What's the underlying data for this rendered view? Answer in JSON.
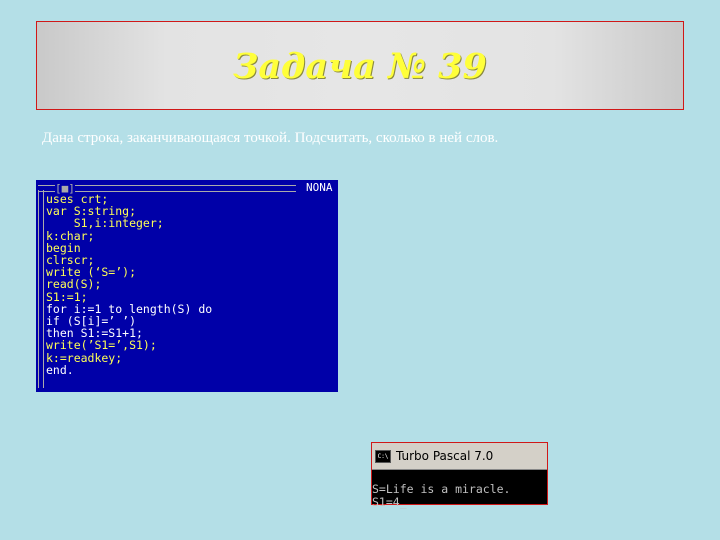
{
  "slide": {
    "title": "Задача № 39",
    "task_text": "Дана строка, заканчивающаяся точкой. Подсчитать, сколько в ней слов."
  },
  "editor": {
    "close_button": "[■]",
    "filename": "NONA",
    "lines": [
      "uses crt;",
      "var S:string;",
      "    S1,i:integer;",
      "k:char;",
      "begin",
      "clrscr;",
      "write (‘S=’);",
      "read(S);",
      "S1:=1;",
      "for i:=1 to length(S) do",
      "if (S[i]=’ ’)",
      "then S1:=S1+1;",
      "write(’S1=’,S1);",
      "k:=readkey;",
      "end."
    ],
    "colors": {
      "background": "#0000a8",
      "text": "#ffff55"
    }
  },
  "console": {
    "icon": "C:\\",
    "title": "Turbo Pascal 7.0",
    "output": [
      "S=Life is a miracle.",
      "S1=4_"
    ]
  }
}
